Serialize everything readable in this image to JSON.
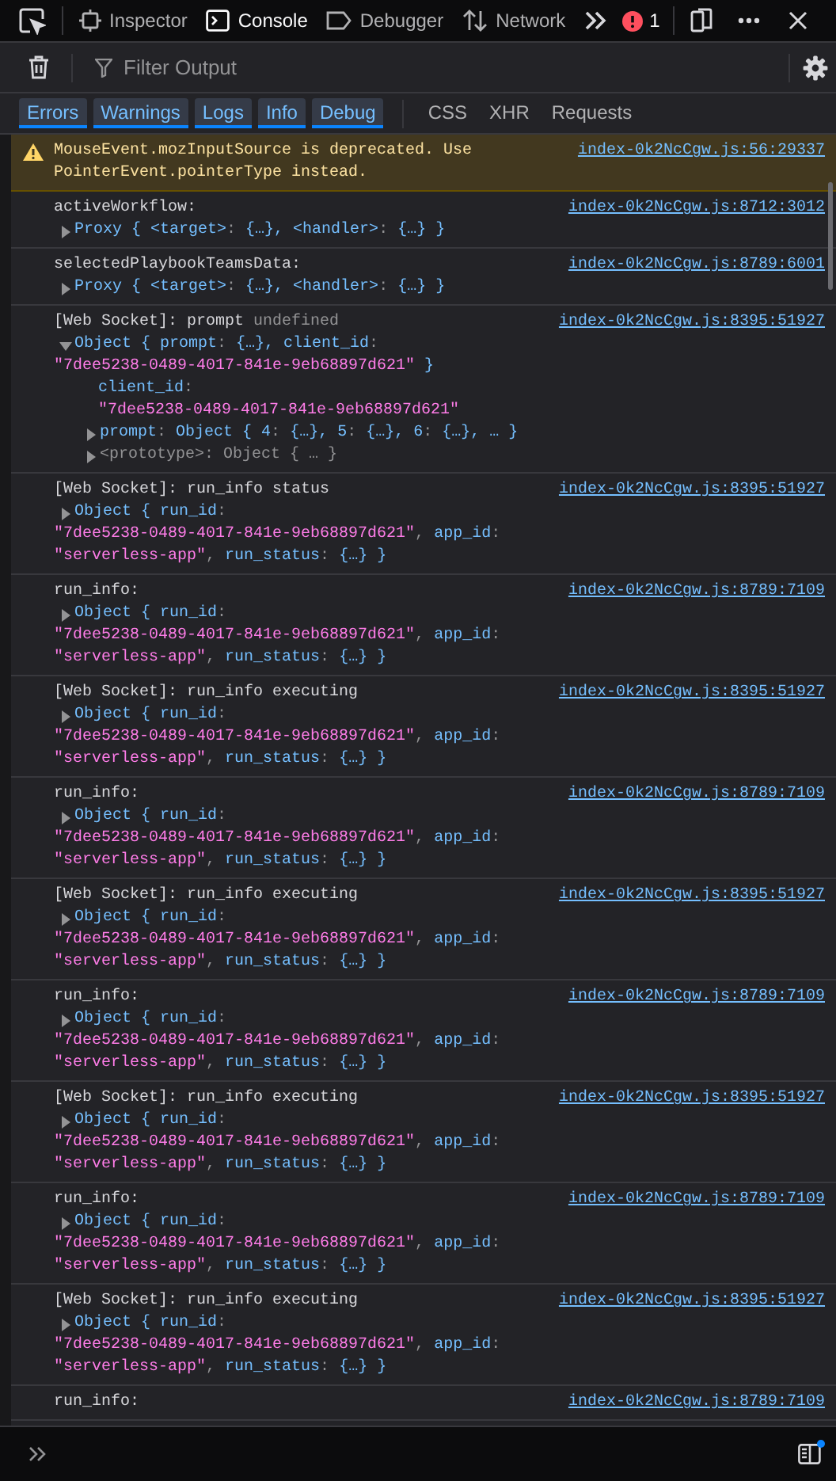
{
  "toolbar": {
    "tabs": [
      {
        "label": "Inspector",
        "selected": false
      },
      {
        "label": "Console",
        "selected": true
      },
      {
        "label": "Debugger",
        "selected": false
      },
      {
        "label": "Network",
        "selected": false
      }
    ],
    "error_count": "1"
  },
  "filter": {
    "placeholder": "Filter Output"
  },
  "filter_buttons": [
    {
      "label": "Errors",
      "selected": true
    },
    {
      "label": "Warnings",
      "selected": true
    },
    {
      "label": "Logs",
      "selected": true
    },
    {
      "label": "Info",
      "selected": true
    },
    {
      "label": "Debug",
      "selected": true
    }
  ],
  "type_buttons": [
    {
      "label": "CSS",
      "selected": false
    },
    {
      "label": "XHR",
      "selected": false
    },
    {
      "label": "Requests",
      "selected": false
    }
  ],
  "messages": [
    {
      "kind": "warning",
      "location": "index-0k2NcCgw.js:56:29337",
      "lines": [
        {
          "kind": "header",
          "segs": [
            {
              "kind": "plain",
              "text": "MouseEvent.mozInputSource is deprecated. Use"
            }
          ]
        },
        {
          "kind": "header",
          "segs": [
            {
              "kind": "plain",
              "text": "PointerEvent.pointerType instead."
            }
          ]
        }
      ]
    },
    {
      "kind": "log",
      "location": "index-0k2NcCgw.js:8712:3012",
      "lines": [
        {
          "kind": "header",
          "segs": [
            {
              "kind": "plain",
              "text": "activeWorkflow:"
            }
          ]
        },
        {
          "kind": "object",
          "expanded": false,
          "segs": [
            {
              "kind": "obj",
              "text": "Proxy { "
            },
            {
              "kind": "obj",
              "text": "<target>"
            },
            {
              "kind": "punct",
              "text": ": "
            },
            {
              "kind": "obj",
              "text": "{…}, <handler>"
            },
            {
              "kind": "punct",
              "text": ": "
            },
            {
              "kind": "obj",
              "text": "{…} }"
            }
          ]
        }
      ]
    },
    {
      "kind": "log",
      "location": "index-0k2NcCgw.js:8789:6001",
      "lines": [
        {
          "kind": "header",
          "segs": [
            {
              "kind": "plain",
              "text": "selectedPlaybookTeamsData:"
            }
          ]
        },
        {
          "kind": "object",
          "expanded": false,
          "segs": [
            {
              "kind": "obj",
              "text": "Proxy { "
            },
            {
              "kind": "obj",
              "text": "<target>"
            },
            {
              "kind": "punct",
              "text": ": "
            },
            {
              "kind": "obj",
              "text": "{…}, <handler>"
            },
            {
              "kind": "punct",
              "text": ": "
            },
            {
              "kind": "obj",
              "text": "{…} }"
            }
          ]
        }
      ]
    },
    {
      "kind": "log",
      "location": "index-0k2NcCgw.js:8395:51927",
      "lines": [
        {
          "kind": "header",
          "segs": [
            {
              "kind": "plain",
              "text": "[Web Socket]: prompt "
            },
            {
              "kind": "muted",
              "text": "undefined"
            }
          ]
        },
        {
          "kind": "object",
          "expanded": true,
          "segs": [
            {
              "kind": "obj",
              "text": "Object { prompt"
            },
            {
              "kind": "punct",
              "text": ": "
            },
            {
              "kind": "obj",
              "text": "{…}, client_id"
            },
            {
              "kind": "punct",
              "text": ":"
            }
          ]
        },
        {
          "kind": "wrap",
          "segs": [
            {
              "kind": "str",
              "text": "\"7dee5238-0489-4017-841e-9eb68897d621\""
            },
            {
              "kind": "obj",
              "text": " }"
            }
          ]
        },
        {
          "kind": "child",
          "segs": [
            {
              "kind": "obj",
              "text": "client_id"
            },
            {
              "kind": "punct",
              "text": ":"
            }
          ]
        },
        {
          "kind": "child",
          "segs": [
            {
              "kind": "str",
              "text": "\"7dee5238-0489-4017-841e-9eb68897d621\""
            }
          ]
        },
        {
          "kind": "child-object",
          "expanded": false,
          "segs": [
            {
              "kind": "obj",
              "text": "prompt"
            },
            {
              "kind": "punct",
              "text": ": "
            },
            {
              "kind": "obj",
              "text": "Object { 4"
            },
            {
              "kind": "punct",
              "text": ": "
            },
            {
              "kind": "obj",
              "text": "{…}, 5"
            },
            {
              "kind": "punct",
              "text": ": "
            },
            {
              "kind": "obj",
              "text": "{…}, 6"
            },
            {
              "kind": "punct",
              "text": ": "
            },
            {
              "kind": "obj",
              "text": "{…}, … }"
            }
          ]
        },
        {
          "kind": "child-object",
          "expanded": false,
          "segs": [
            {
              "kind": "muted",
              "text": "<prototype>: Object { … }"
            }
          ]
        }
      ]
    },
    {
      "kind": "log",
      "location": "index-0k2NcCgw.js:8395:51927",
      "lines": [
        {
          "kind": "header",
          "segs": [
            {
              "kind": "plain",
              "text": "[Web Socket]: run_info status"
            }
          ]
        },
        {
          "kind": "object",
          "expanded": false,
          "segs": [
            {
              "kind": "obj",
              "text": "Object { run_id"
            },
            {
              "kind": "punct",
              "text": ":"
            }
          ]
        },
        {
          "kind": "wrap",
          "segs": [
            {
              "kind": "str",
              "text": "\"7dee5238-0489-4017-841e-9eb68897d621\""
            },
            {
              "kind": "punct",
              "text": ", "
            },
            {
              "kind": "obj",
              "text": "app_id"
            },
            {
              "kind": "punct",
              "text": ":"
            }
          ]
        },
        {
          "kind": "wrap",
          "segs": [
            {
              "kind": "str",
              "text": "\"serverless-app\""
            },
            {
              "kind": "punct",
              "text": ", "
            },
            {
              "kind": "obj",
              "text": "run_status"
            },
            {
              "kind": "punct",
              "text": ": "
            },
            {
              "kind": "obj",
              "text": "{…} }"
            }
          ]
        }
      ]
    },
    {
      "kind": "log",
      "location": "index-0k2NcCgw.js:8789:7109",
      "lines": [
        {
          "kind": "header",
          "segs": [
            {
              "kind": "plain",
              "text": "run_info:"
            }
          ]
        },
        {
          "kind": "object",
          "expanded": false,
          "segs": [
            {
              "kind": "obj",
              "text": "Object { run_id"
            },
            {
              "kind": "punct",
              "text": ":"
            }
          ]
        },
        {
          "kind": "wrap",
          "segs": [
            {
              "kind": "str",
              "text": "\"7dee5238-0489-4017-841e-9eb68897d621\""
            },
            {
              "kind": "punct",
              "text": ", "
            },
            {
              "kind": "obj",
              "text": "app_id"
            },
            {
              "kind": "punct",
              "text": ":"
            }
          ]
        },
        {
          "kind": "wrap",
          "segs": [
            {
              "kind": "str",
              "text": "\"serverless-app\""
            },
            {
              "kind": "punct",
              "text": ", "
            },
            {
              "kind": "obj",
              "text": "run_status"
            },
            {
              "kind": "punct",
              "text": ": "
            },
            {
              "kind": "obj",
              "text": "{…} }"
            }
          ]
        }
      ]
    },
    {
      "kind": "log",
      "location": "index-0k2NcCgw.js:8395:51927",
      "lines": [
        {
          "kind": "header",
          "segs": [
            {
              "kind": "plain",
              "text": "[Web Socket]: run_info executing"
            }
          ]
        },
        {
          "kind": "object",
          "expanded": false,
          "segs": [
            {
              "kind": "obj",
              "text": "Object { run_id"
            },
            {
              "kind": "punct",
              "text": ":"
            }
          ]
        },
        {
          "kind": "wrap",
          "segs": [
            {
              "kind": "str",
              "text": "\"7dee5238-0489-4017-841e-9eb68897d621\""
            },
            {
              "kind": "punct",
              "text": ", "
            },
            {
              "kind": "obj",
              "text": "app_id"
            },
            {
              "kind": "punct",
              "text": ":"
            }
          ]
        },
        {
          "kind": "wrap",
          "segs": [
            {
              "kind": "str",
              "text": "\"serverless-app\""
            },
            {
              "kind": "punct",
              "text": ", "
            },
            {
              "kind": "obj",
              "text": "run_status"
            },
            {
              "kind": "punct",
              "text": ": "
            },
            {
              "kind": "obj",
              "text": "{…} }"
            }
          ]
        }
      ]
    },
    {
      "kind": "log",
      "location": "index-0k2NcCgw.js:8789:7109",
      "lines": [
        {
          "kind": "header",
          "segs": [
            {
              "kind": "plain",
              "text": "run_info:"
            }
          ]
        },
        {
          "kind": "object",
          "expanded": false,
          "segs": [
            {
              "kind": "obj",
              "text": "Object { run_id"
            },
            {
              "kind": "punct",
              "text": ":"
            }
          ]
        },
        {
          "kind": "wrap",
          "segs": [
            {
              "kind": "str",
              "text": "\"7dee5238-0489-4017-841e-9eb68897d621\""
            },
            {
              "kind": "punct",
              "text": ", "
            },
            {
              "kind": "obj",
              "text": "app_id"
            },
            {
              "kind": "punct",
              "text": ":"
            }
          ]
        },
        {
          "kind": "wrap",
          "segs": [
            {
              "kind": "str",
              "text": "\"serverless-app\""
            },
            {
              "kind": "punct",
              "text": ", "
            },
            {
              "kind": "obj",
              "text": "run_status"
            },
            {
              "kind": "punct",
              "text": ": "
            },
            {
              "kind": "obj",
              "text": "{…} }"
            }
          ]
        }
      ]
    },
    {
      "kind": "log",
      "location": "index-0k2NcCgw.js:8395:51927",
      "lines": [
        {
          "kind": "header",
          "segs": [
            {
              "kind": "plain",
              "text": "[Web Socket]: run_info executing"
            }
          ]
        },
        {
          "kind": "object",
          "expanded": false,
          "segs": [
            {
              "kind": "obj",
              "text": "Object { run_id"
            },
            {
              "kind": "punct",
              "text": ":"
            }
          ]
        },
        {
          "kind": "wrap",
          "segs": [
            {
              "kind": "str",
              "text": "\"7dee5238-0489-4017-841e-9eb68897d621\""
            },
            {
              "kind": "punct",
              "text": ", "
            },
            {
              "kind": "obj",
              "text": "app_id"
            },
            {
              "kind": "punct",
              "text": ":"
            }
          ]
        },
        {
          "kind": "wrap",
          "segs": [
            {
              "kind": "str",
              "text": "\"serverless-app\""
            },
            {
              "kind": "punct",
              "text": ", "
            },
            {
              "kind": "obj",
              "text": "run_status"
            },
            {
              "kind": "punct",
              "text": ": "
            },
            {
              "kind": "obj",
              "text": "{…} }"
            }
          ]
        }
      ]
    },
    {
      "kind": "log",
      "location": "index-0k2NcCgw.js:8789:7109",
      "lines": [
        {
          "kind": "header",
          "segs": [
            {
              "kind": "plain",
              "text": "run_info:"
            }
          ]
        },
        {
          "kind": "object",
          "expanded": false,
          "segs": [
            {
              "kind": "obj",
              "text": "Object { run_id"
            },
            {
              "kind": "punct",
              "text": ":"
            }
          ]
        },
        {
          "kind": "wrap",
          "segs": [
            {
              "kind": "str",
              "text": "\"7dee5238-0489-4017-841e-9eb68897d621\""
            },
            {
              "kind": "punct",
              "text": ", "
            },
            {
              "kind": "obj",
              "text": "app_id"
            },
            {
              "kind": "punct",
              "text": ":"
            }
          ]
        },
        {
          "kind": "wrap",
          "segs": [
            {
              "kind": "str",
              "text": "\"serverless-app\""
            },
            {
              "kind": "punct",
              "text": ", "
            },
            {
              "kind": "obj",
              "text": "run_status"
            },
            {
              "kind": "punct",
              "text": ": "
            },
            {
              "kind": "obj",
              "text": "{…} }"
            }
          ]
        }
      ]
    },
    {
      "kind": "log",
      "location": "index-0k2NcCgw.js:8395:51927",
      "lines": [
        {
          "kind": "header",
          "segs": [
            {
              "kind": "plain",
              "text": "[Web Socket]: run_info executing"
            }
          ]
        },
        {
          "kind": "object",
          "expanded": false,
          "segs": [
            {
              "kind": "obj",
              "text": "Object { run_id"
            },
            {
              "kind": "punct",
              "text": ":"
            }
          ]
        },
        {
          "kind": "wrap",
          "segs": [
            {
              "kind": "str",
              "text": "\"7dee5238-0489-4017-841e-9eb68897d621\""
            },
            {
              "kind": "punct",
              "text": ", "
            },
            {
              "kind": "obj",
              "text": "app_id"
            },
            {
              "kind": "punct",
              "text": ":"
            }
          ]
        },
        {
          "kind": "wrap",
          "segs": [
            {
              "kind": "str",
              "text": "\"serverless-app\""
            },
            {
              "kind": "punct",
              "text": ", "
            },
            {
              "kind": "obj",
              "text": "run_status"
            },
            {
              "kind": "punct",
              "text": ": "
            },
            {
              "kind": "obj",
              "text": "{…} }"
            }
          ]
        }
      ]
    },
    {
      "kind": "log",
      "location": "index-0k2NcCgw.js:8789:7109",
      "lines": [
        {
          "kind": "header",
          "segs": [
            {
              "kind": "plain",
              "text": "run_info:"
            }
          ]
        },
        {
          "kind": "object",
          "expanded": false,
          "segs": [
            {
              "kind": "obj",
              "text": "Object { run_id"
            },
            {
              "kind": "punct",
              "text": ":"
            }
          ]
        },
        {
          "kind": "wrap",
          "segs": [
            {
              "kind": "str",
              "text": "\"7dee5238-0489-4017-841e-9eb68897d621\""
            },
            {
              "kind": "punct",
              "text": ", "
            },
            {
              "kind": "obj",
              "text": "app_id"
            },
            {
              "kind": "punct",
              "text": ":"
            }
          ]
        },
        {
          "kind": "wrap",
          "segs": [
            {
              "kind": "str",
              "text": "\"serverless-app\""
            },
            {
              "kind": "punct",
              "text": ", "
            },
            {
              "kind": "obj",
              "text": "run_status"
            },
            {
              "kind": "punct",
              "text": ": "
            },
            {
              "kind": "obj",
              "text": "{…} }"
            }
          ]
        }
      ]
    },
    {
      "kind": "log",
      "location": "index-0k2NcCgw.js:8395:51927",
      "lines": [
        {
          "kind": "header",
          "segs": [
            {
              "kind": "plain",
              "text": "[Web Socket]: run_info executing"
            }
          ]
        },
        {
          "kind": "object",
          "expanded": false,
          "segs": [
            {
              "kind": "obj",
              "text": "Object { run_id"
            },
            {
              "kind": "punct",
              "text": ":"
            }
          ]
        },
        {
          "kind": "wrap",
          "segs": [
            {
              "kind": "str",
              "text": "\"7dee5238-0489-4017-841e-9eb68897d621\""
            },
            {
              "kind": "punct",
              "text": ", "
            },
            {
              "kind": "obj",
              "text": "app_id"
            },
            {
              "kind": "punct",
              "text": ":"
            }
          ]
        },
        {
          "kind": "wrap",
          "segs": [
            {
              "kind": "str",
              "text": "\"serverless-app\""
            },
            {
              "kind": "punct",
              "text": ", "
            },
            {
              "kind": "obj",
              "text": "run_status"
            },
            {
              "kind": "punct",
              "text": ": "
            },
            {
              "kind": "obj",
              "text": "{…} }"
            }
          ]
        }
      ]
    },
    {
      "kind": "log",
      "location": "index-0k2NcCgw.js:8789:7109",
      "lines": [
        {
          "kind": "header",
          "segs": [
            {
              "kind": "plain",
              "text": "run_info:"
            }
          ]
        }
      ]
    }
  ]
}
